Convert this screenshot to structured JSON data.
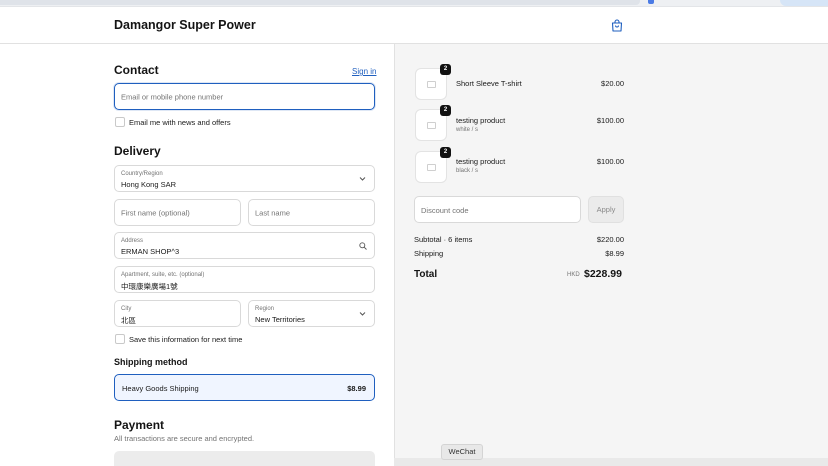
{
  "header": {
    "brand": "Damangor Super Power",
    "cart_icon": "shopping-bag-icon"
  },
  "contact": {
    "heading": "Contact",
    "sign_in": "Sign in",
    "email_placeholder": "Email or mobile phone number",
    "news_label": "Email me with news and offers"
  },
  "delivery": {
    "heading": "Delivery",
    "country_label": "Country/Region",
    "country_value": "Hong Kong SAR",
    "first_name_placeholder": "First name (optional)",
    "last_name_placeholder": "Last name",
    "address_label": "Address",
    "address_value": "ERMAN SHOP^3",
    "apartment_label": "Apartment, suite, etc. (optional)",
    "apartment_value": "中環康樂廣場1號",
    "city_label": "City",
    "city_value": "北區",
    "region_label": "Region",
    "region_value": "New Territories",
    "save_label": "Save this information for next time"
  },
  "shipping": {
    "heading": "Shipping method",
    "option_name": "Heavy Goods Shipping",
    "option_price": "$8.99"
  },
  "payment": {
    "heading": "Payment",
    "subtitle": "All transactions are secure and encrypted."
  },
  "order": {
    "items": [
      {
        "qty": "2",
        "title": "Short Sleeve T-shirt",
        "variant": "",
        "price": "$20.00"
      },
      {
        "qty": "2",
        "title": "testing product",
        "variant": "white / s",
        "price": "$100.00"
      },
      {
        "qty": "2",
        "title": "testing product",
        "variant": "black / s",
        "price": "$100.00"
      }
    ],
    "discount_placeholder": "Discount code",
    "apply_label": "Apply",
    "subtotal_label": "Subtotal · 6 items",
    "subtotal_value": "$220.00",
    "shipping_label": "Shipping",
    "shipping_value": "$8.99",
    "total_label": "Total",
    "total_currency": "HKD",
    "total_value": "$228.99"
  },
  "overlay": {
    "wechat_label": "WeChat"
  },
  "colors": {
    "accent": "#1f5fbf",
    "summary_bg": "#f5f5f5"
  }
}
